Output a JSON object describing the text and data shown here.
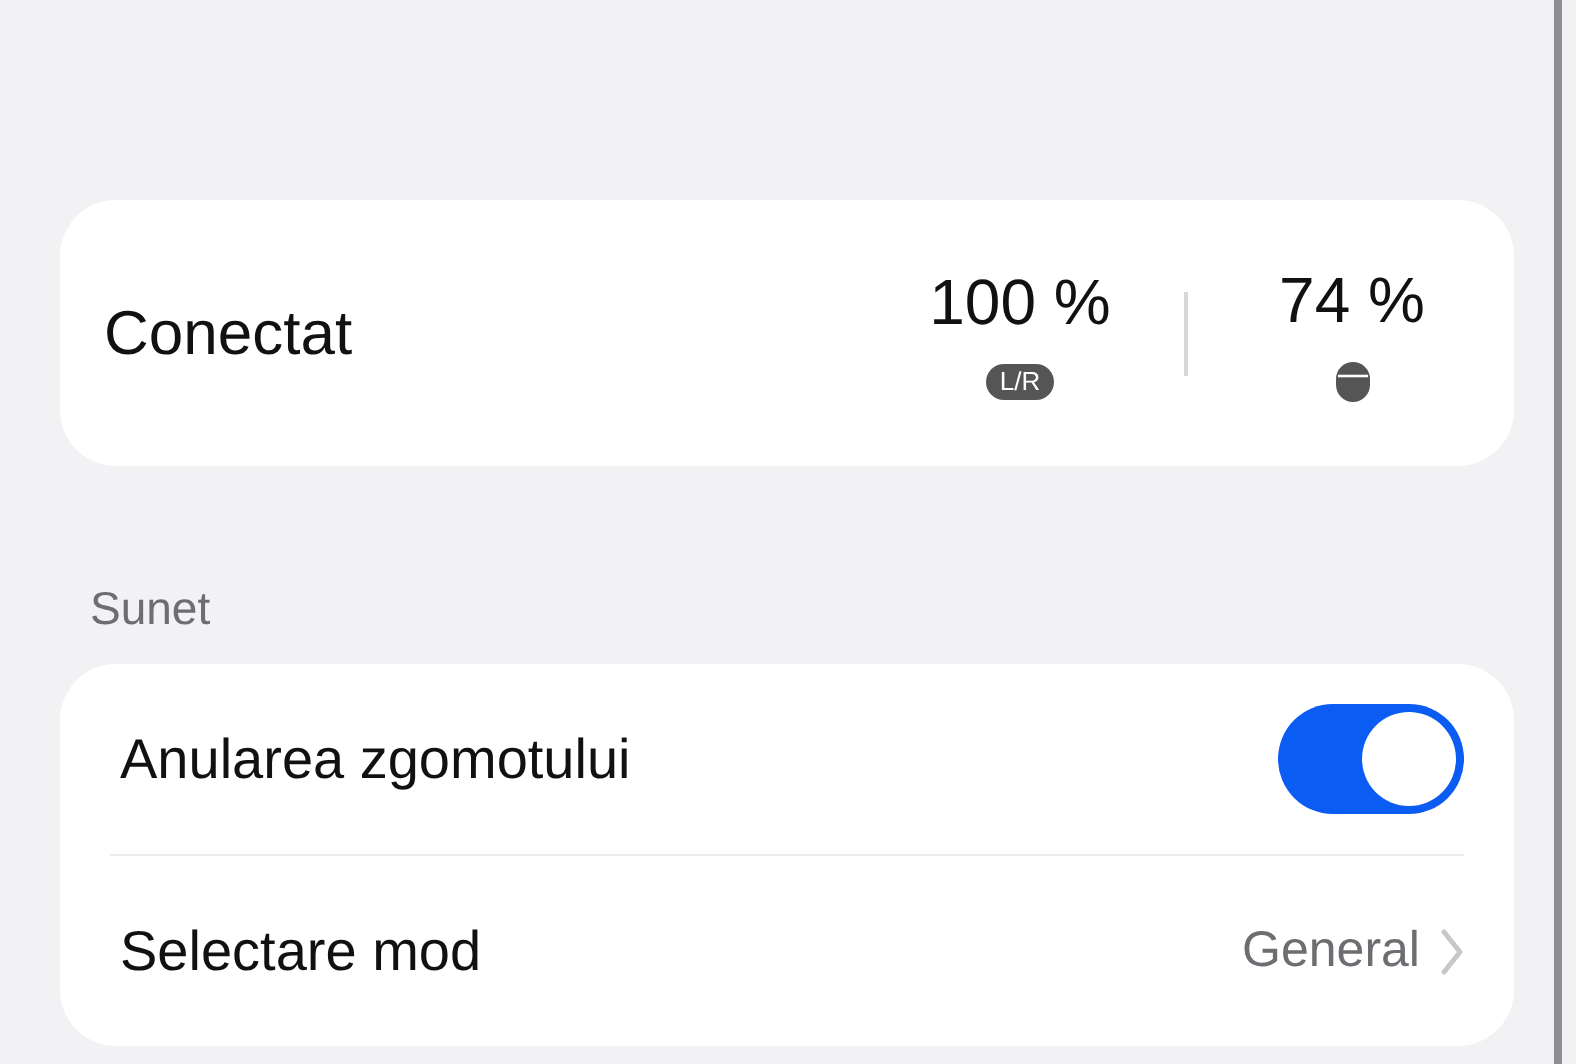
{
  "status": {
    "label": "Conectat",
    "batteries": [
      {
        "reading": "100 %",
        "kind": "badge",
        "badge": "L/R"
      },
      {
        "reading": "74 %",
        "kind": "case"
      }
    ]
  },
  "sections": [
    {
      "title": "Sunet",
      "rows": [
        {
          "kind": "toggle",
          "label": "Anularea zgomotului",
          "on": true
        },
        {
          "kind": "value",
          "label": "Selectare mod",
          "value": "General"
        }
      ]
    }
  ]
}
